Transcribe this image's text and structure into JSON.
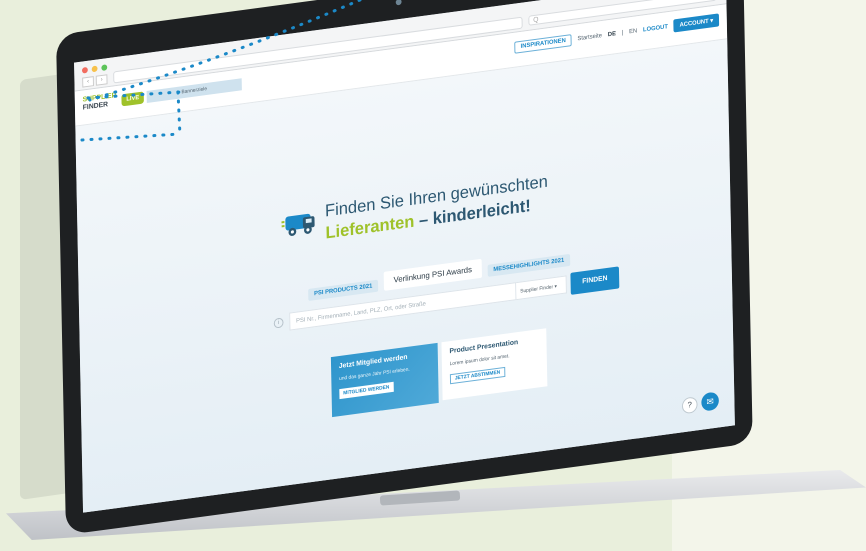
{
  "browser": {
    "search_placeholder": "Q"
  },
  "header": {
    "logo_line1": "SUPPLIER",
    "logo_line2": "FINDER",
    "live_badge": "LIVE",
    "tab_label": "Bannerziele",
    "nav": {
      "inspirations": "INSPIRATIONEN",
      "start": "Startseite",
      "lang_de": "DE",
      "lang_sep": "|",
      "lang_en": "EN",
      "logout": "LOGOUT",
      "account": "ACCOUNT"
    }
  },
  "hero": {
    "title_line1": "Finden Sie Ihren gewünschten",
    "title_accent": "Lieferanten",
    "title_rest": " – kinderleicht!",
    "tabs": [
      {
        "label": "PSI PRODUCTS 2021",
        "active": false
      },
      {
        "label": "Verlinkung PSI Awards",
        "active": true
      },
      {
        "label": "MESSEHIGHLIGHTS 2021",
        "active": false
      }
    ],
    "search_placeholder": "PSI Nr., Firmenname, Land, PLZ, Ort, oder Straße",
    "select_value": "Supplier Finder",
    "search_button": "FINDEN"
  },
  "cards": {
    "member": {
      "title": "Jetzt Mitglied werden",
      "text": "und das ganze Jahr PSI erleben.",
      "button": "MITGLIED WERDEN"
    },
    "product": {
      "title": "Product Presentation",
      "text": "Lorem ipsum dolor sit amet.",
      "button": "JETZT ABSTIMMEN"
    }
  },
  "colors": {
    "accent_blue": "#1b89c8",
    "accent_green": "#9fc22a",
    "title_blue": "#2d5872"
  },
  "icons": {
    "help": "?",
    "chat": "chat-icon"
  }
}
